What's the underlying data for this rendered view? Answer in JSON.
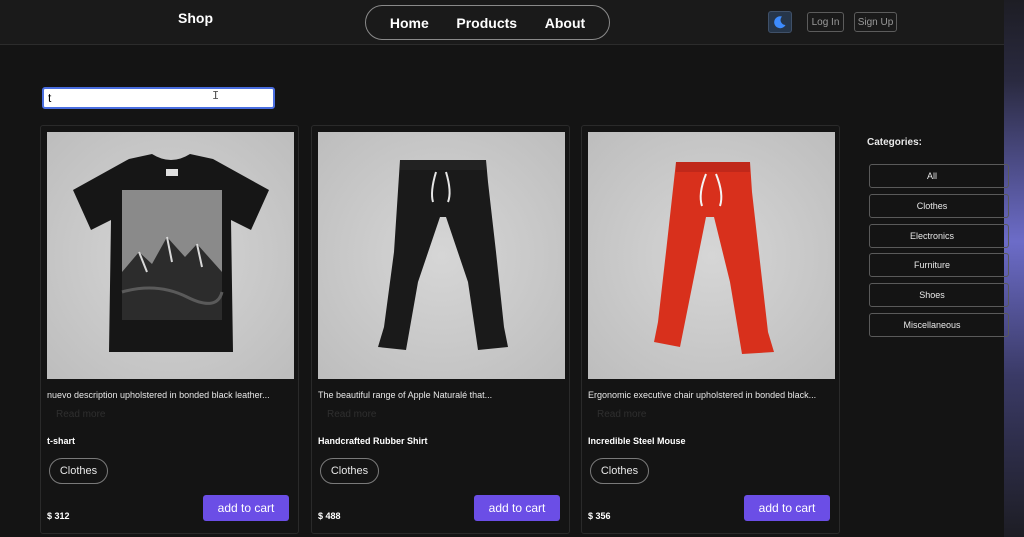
{
  "header": {
    "brand": "Shop",
    "nav": [
      "Home",
      "Products",
      "About"
    ],
    "login_label": "Log In",
    "signup_label": "Sign Up",
    "theme_icon": "moon-icon"
  },
  "search": {
    "value": "t"
  },
  "products": [
    {
      "description": "nuevo description upholstered in bonded black leather...",
      "read_more": "Read more",
      "title": "t-shart",
      "category": "Clothes",
      "price": "$ 312",
      "add_label": "add to cart",
      "image_icon": "black-tshirt-image"
    },
    {
      "description": "The beautiful range of Apple Naturalé that...",
      "read_more": "Read more",
      "title": "Handcrafted Rubber Shirt",
      "category": "Clothes",
      "price": "$ 488",
      "add_label": "add to cart",
      "image_icon": "black-joggers-image"
    },
    {
      "description": "Ergonomic executive chair upholstered in bonded black...",
      "read_more": "Read more",
      "title": "Incredible Steel Mouse",
      "category": "Clothes",
      "price": "$ 356",
      "add_label": "add to cart",
      "image_icon": "red-joggers-image"
    }
  ],
  "categories": {
    "heading": "Categories:",
    "items": [
      "All",
      "Clothes",
      "Electronics",
      "Furniture",
      "Shoes",
      "Miscellaneous"
    ]
  },
  "colors": {
    "background": "#141414",
    "accent": "#6b4ee6",
    "search_border": "#4a6ee0"
  }
}
